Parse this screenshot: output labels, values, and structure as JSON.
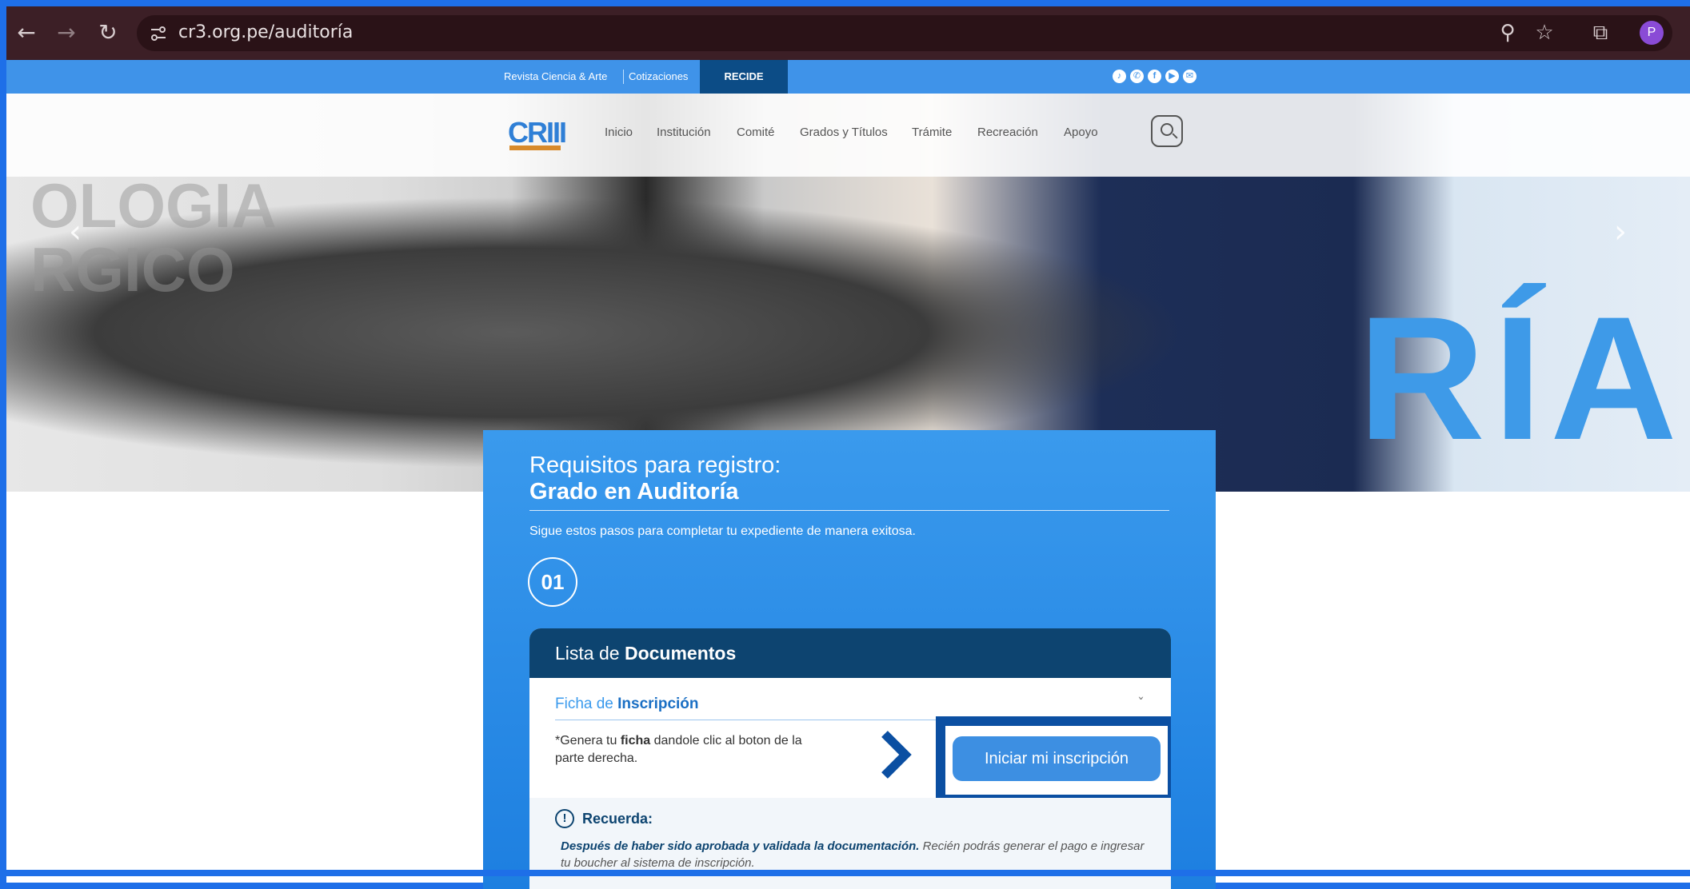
{
  "browser": {
    "url": "cr3.org.pe/auditoría",
    "avatar_letter": "P",
    "back_icon": "←",
    "forward_icon": "→",
    "reload_icon": "↻",
    "zoom_icon": "⚲",
    "star_icon": "☆",
    "extensions_icon": "⧉"
  },
  "topbar": {
    "link_revista": "Revista Ciencia & Arte",
    "link_cotizaciones": "Cotizaciones",
    "link_recide": "RECIDE",
    "social_icons": [
      "tiktok-icon",
      "whatsapp-icon",
      "facebook-icon",
      "youtube-icon",
      "mail-icon"
    ]
  },
  "header": {
    "logo_text": "CRIII",
    "menu": [
      "Inicio",
      "Institución",
      "Comité",
      "Grados y Títulos",
      "Trámite",
      "Recreación",
      "Apoyo"
    ]
  },
  "card": {
    "title_line1": "Requisitos para registro:",
    "title_line2": "Grado en Auditoría",
    "subtitle": "Sigue estos pasos para completar tu expediente de manera exitosa.",
    "step_number": "01",
    "documents": {
      "heading_regular": "Lista de ",
      "heading_bold": "Documentos",
      "item_regular": "Ficha de ",
      "item_bold": "Inscripción",
      "note_prefix": "*Genera tu ",
      "note_bold": "ficha",
      "note_suffix": " dandole clic al boton de la parte derecha.",
      "button_label": "Iniciar mi inscripción"
    },
    "reminder": {
      "title": "Recuerda:",
      "bold_text": "Después de haber sido aprobada y validada la documentación.",
      "rest_text": " Recién podrás generar el pago e ingresar tu boucher al sistema de inscripción."
    }
  },
  "colors": {
    "accent_blue": "#3a9aed",
    "dark_navy": "#0d4470",
    "highlight_frame": "#0b4fa2"
  }
}
